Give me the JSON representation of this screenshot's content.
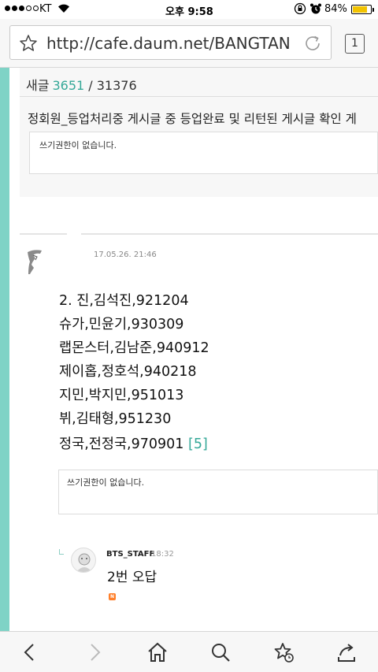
{
  "status_bar": {
    "carrier": "KT",
    "time": "오후 9:58",
    "battery_percent": "84%",
    "battery_level": 0.84,
    "signal_bars": 3,
    "icons": [
      "wifi-icon",
      "orientation-lock-icon",
      "alarm-icon",
      "battery-icon"
    ]
  },
  "browser": {
    "url": "http://cafe.daum.net/BANGTAN",
    "tab_count": "1",
    "icons": [
      "bookmark-star-icon",
      "reload-icon"
    ]
  },
  "board": {
    "new_label": "새글",
    "new_count": "3651",
    "total_count": "/ 31376"
  },
  "notice": {
    "title": "정회원_등업처리중 게시글 중 등업완료 및 리턴된 게시글 확인 게",
    "no_permission": "쓰기권한이 없습니다."
  },
  "post": {
    "timestamp": "17.05.26. 21:46",
    "lines": [
      "2. 진,김석진,921204",
      "슈가,민윤기,930309",
      "랩몬스터,김남준,940912",
      "제이홉,정호석,940218",
      "지민,박지민,951013",
      "뷔,김태형,951230",
      "정국,전정국,970901"
    ],
    "comment_count": "[5]",
    "no_permission": "쓰기권한이 없습니다."
  },
  "reply": {
    "author": "BTS_STAFF",
    "time": "18:32",
    "text": "2번 오답",
    "badge": "N"
  },
  "toolbar": {
    "items": [
      "back-icon",
      "forward-icon",
      "home-icon",
      "search-icon",
      "bookmarks-icon",
      "share-icon"
    ]
  },
  "colors": {
    "accent": "#7fd3c6",
    "link_teal": "#35a898",
    "battery": "#f2c300",
    "new_badge": "#ff7f2a"
  }
}
